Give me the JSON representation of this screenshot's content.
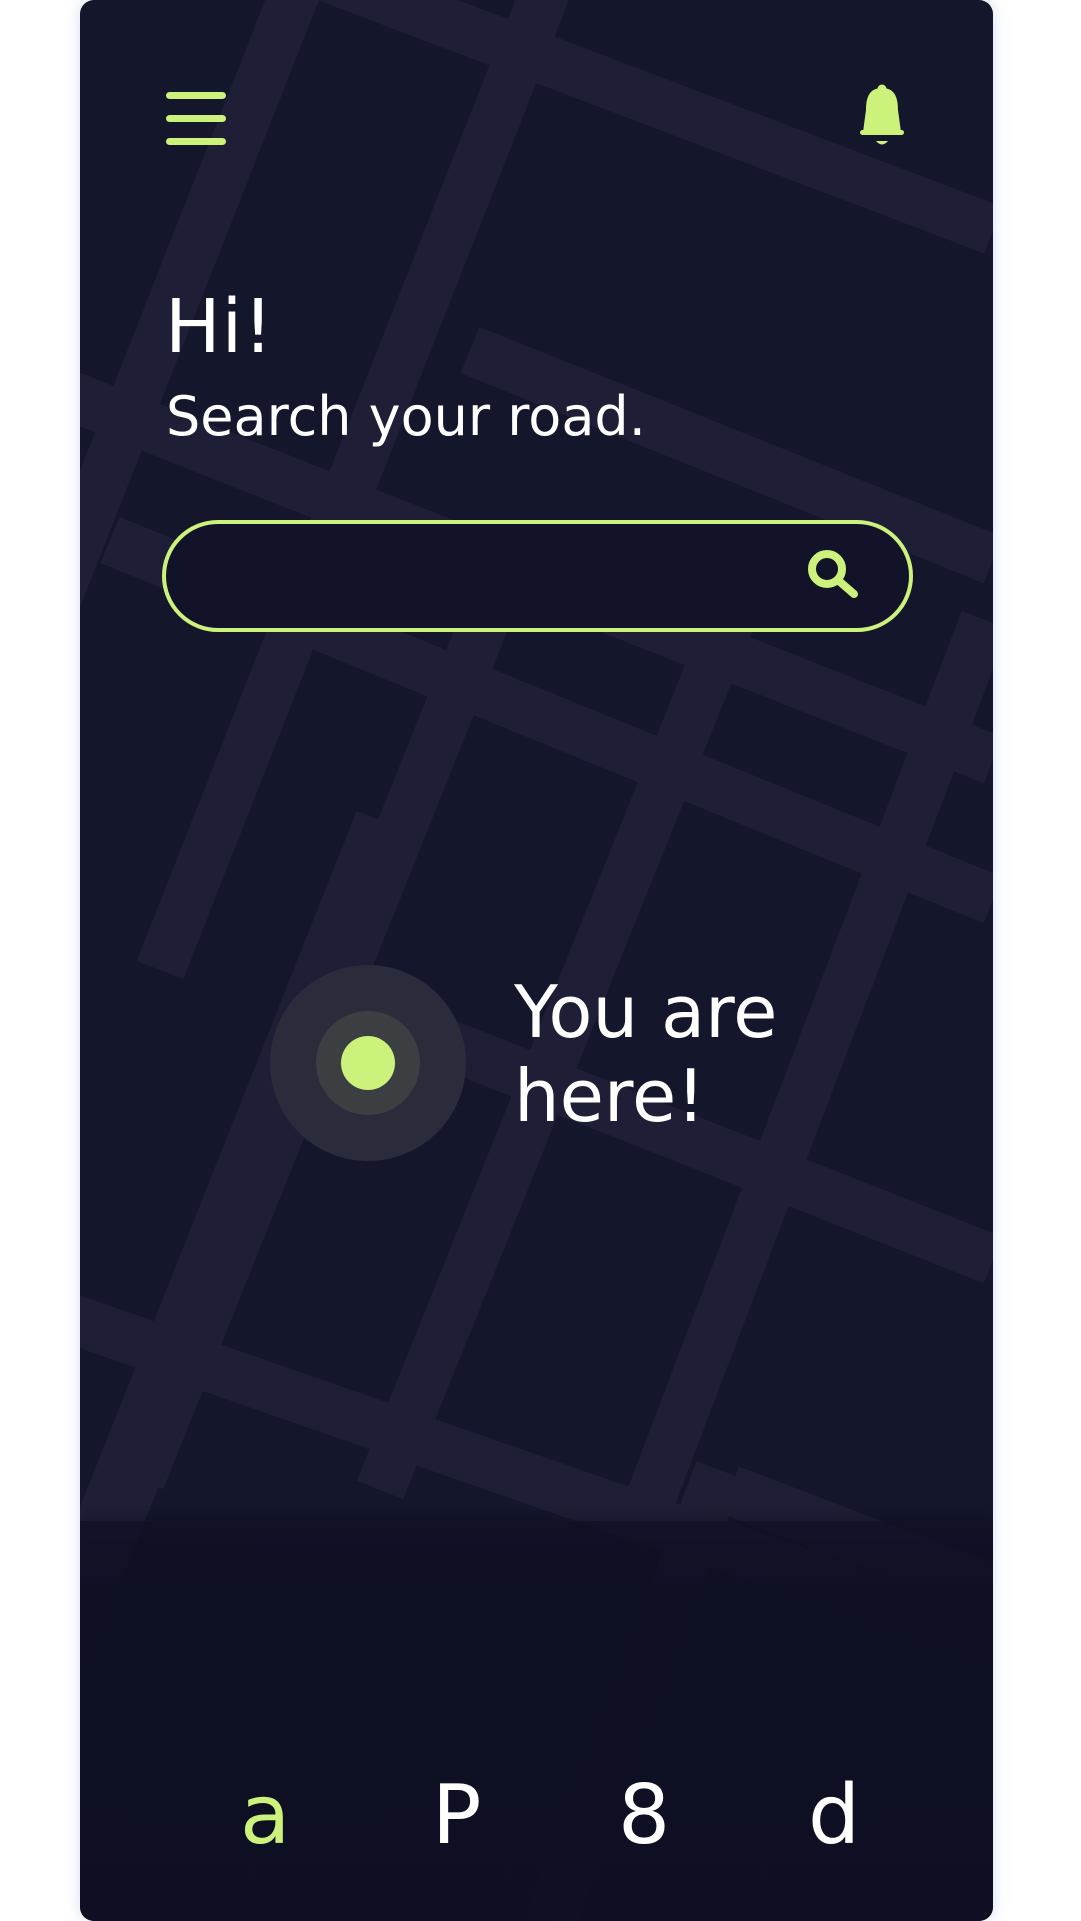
{
  "colors": {
    "background": "#14162b",
    "road": "#1e1f36",
    "accent": "#ccf27c",
    "text": "#ffffff"
  },
  "header": {
    "menu_icon": "hamburger-menu-icon",
    "notification_icon": "bell-icon"
  },
  "greeting": {
    "title": "Hi!",
    "subtitle": "Search your road."
  },
  "search": {
    "value": "",
    "placeholder": "",
    "icon": "search-icon"
  },
  "location": {
    "label": "You are here!"
  },
  "bottom_nav": {
    "items": [
      {
        "glyph": "a",
        "active": true
      },
      {
        "glyph": "P",
        "active": false
      },
      {
        "glyph": "8",
        "active": false
      },
      {
        "glyph": "d",
        "active": false
      }
    ]
  }
}
